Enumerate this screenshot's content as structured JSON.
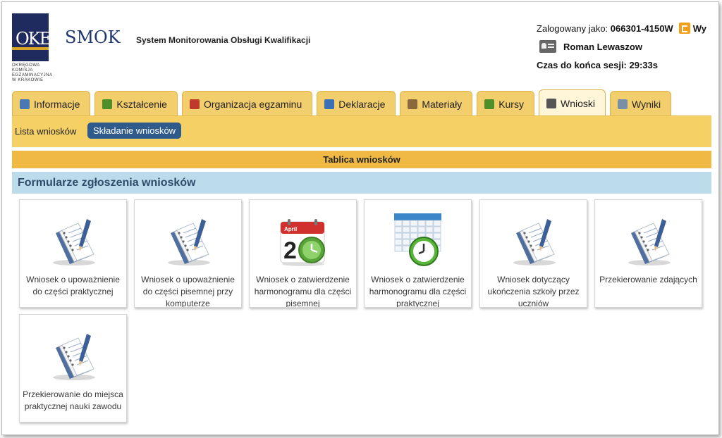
{
  "header": {
    "logo_text": "OKE",
    "logo_sub": "OKRĘGOWA KOMISJA EGZAMINACYJNA W KRAKOWIE",
    "app_name": "SMOK",
    "app_description": "System Monitorowania Obsługi Kwalifikacji",
    "logged_as_label": "Zalogowany jako:",
    "login_id": "066301-4150W",
    "logout_label": "Wy",
    "user_name": "Roman Lewaszow",
    "session_label": "Czas do końca sesji: 29:33s"
  },
  "tabs": [
    {
      "label": "Informacje",
      "icon": "info-people-icon",
      "color": "#4a78b5"
    },
    {
      "label": "Kształcenie",
      "icon": "tree-icon",
      "color": "#4f8f2a"
    },
    {
      "label": "Organizacja egzaminu",
      "icon": "calendar-icon",
      "color": "#c0392b"
    },
    {
      "label": "Deklaracje",
      "icon": "document-icon",
      "color": "#3b6fb6"
    },
    {
      "label": "Materiały",
      "icon": "bag-icon",
      "color": "#8a6a3d"
    },
    {
      "label": "Kursy",
      "icon": "tree-icon",
      "color": "#4f8f2a"
    },
    {
      "label": "Wnioski",
      "icon": "form-icon",
      "color": "#555555"
    },
    {
      "label": "Wyniki",
      "icon": "printer-icon",
      "color": "#7a8fa5"
    }
  ],
  "active_tab": "Wnioski",
  "subnav": {
    "list_label": "Lista wniosków",
    "submit_label": "Składanie wniosków"
  },
  "board_title": "Tablica wniosków",
  "section_title": "Formularze zgłoszenia wniosków",
  "forms": [
    {
      "label": "Wniosek o upoważnienie do części praktycznej",
      "icon": "notepad-pen-icon"
    },
    {
      "label": "Wniosek o upoważnienie do części pisemnej przy komputerze",
      "icon": "notepad-pen-icon"
    },
    {
      "label": "Wniosek o zatwierdzenie harmonogramu dla części pisemnej",
      "icon": "calendar-clock-icon",
      "cal_month": "April",
      "cal_day": "2"
    },
    {
      "label": "Wniosek o zatwierdzenie harmonogramu dla części praktycznej",
      "icon": "table-clock-icon"
    },
    {
      "label": "Wniosek dotyczący ukończenia szkoły przez uczniów",
      "icon": "notepad-pen-icon"
    },
    {
      "label": "Przekierowanie zdających",
      "icon": "notepad-pen-icon"
    },
    {
      "label": "Przekierowanie do miejsca praktycznej nauki zawodu",
      "icon": "notepad-pen-icon"
    }
  ]
}
